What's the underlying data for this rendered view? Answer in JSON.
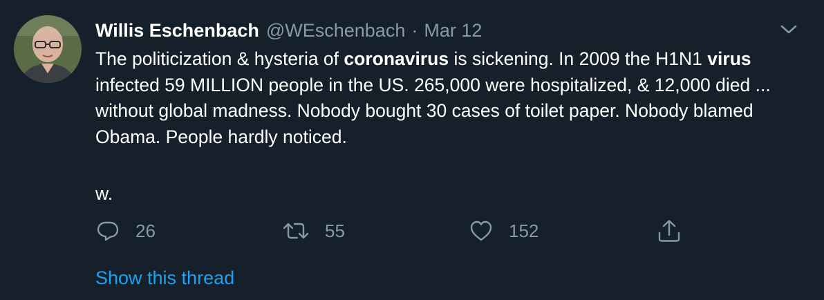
{
  "tweet": {
    "author_name": "Willis Eschenbach",
    "author_handle": "@WEschenbach",
    "separator": "·",
    "date": "Mar 12",
    "body": {
      "p1": "The politicization & hysteria of ",
      "b1": "coronavirus",
      "p2": " is sickening. In 2009 the H1N1 ",
      "b2": "virus",
      "p3": " infected 59 MILLION people in the US. 265,000 were hospitalized, & 12,000 died ... without global madness. Nobody bought 30 cases of toilet paper. Nobody blamed Obama. People hardly noticed."
    },
    "signature": "w.",
    "actions": {
      "replies": "26",
      "retweets": "55",
      "likes": "152"
    },
    "show_thread": "Show this thread"
  },
  "icons": {
    "caret": "chevron-down-icon",
    "reply": "reply-icon",
    "retweet": "retweet-icon",
    "like": "heart-icon",
    "share": "share-icon"
  },
  "colors": {
    "background": "#15202b",
    "primary_text": "#ffffff",
    "secondary_text": "#8899a6",
    "link": "#1da1f2"
  }
}
